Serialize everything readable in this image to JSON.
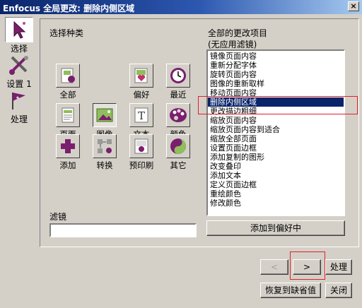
{
  "window": {
    "title": "Enfocus 全局更改: 删除内侧区域",
    "close_label": "×"
  },
  "sidebar": {
    "items": [
      {
        "label": "选择",
        "icon": "cursor-icon"
      },
      {
        "label": "设置 1",
        "icon": "tools-icon"
      },
      {
        "label": "处理",
        "icon": "flag-icon"
      }
    ]
  },
  "main": {
    "category_label": "选择种类",
    "categories": [
      {
        "label": "全部"
      },
      {
        "label": "偏好"
      },
      {
        "label": "最近"
      },
      {
        "label": "页面"
      },
      {
        "label": "图像"
      },
      {
        "label": "文本"
      },
      {
        "label": "颜色"
      },
      {
        "label": "添加"
      },
      {
        "label": "转换"
      },
      {
        "label": "预印刷"
      },
      {
        "label": "其它"
      }
    ],
    "filter_label": "滤镜",
    "filter_value": "",
    "changes_title": "全部的更改项目",
    "changes_subtitle": "(无应用滤镜)",
    "changes": [
      "镜像页面内容",
      "重新分配字体",
      "旋转页面内容",
      "图像的重新取样",
      "移动页面内容",
      "删除内侧区域",
      "更改描边粗细",
      "缩放页面内容",
      "缩放页面内容到适合",
      "缩放全部页面",
      "设置页面边框",
      "添加复制的图形",
      "改变叠印",
      "添加文本",
      "定义页面边框",
      "重绘颜色",
      "修改颜色"
    ],
    "selected_change": "删除内侧区域",
    "add_favorite_label": "添加到偏好中"
  },
  "footer": {
    "back_label": "<",
    "next_label": ">",
    "process_label": "处理",
    "restore_label": "恢复到缺省值",
    "close_label": "关闭"
  }
}
